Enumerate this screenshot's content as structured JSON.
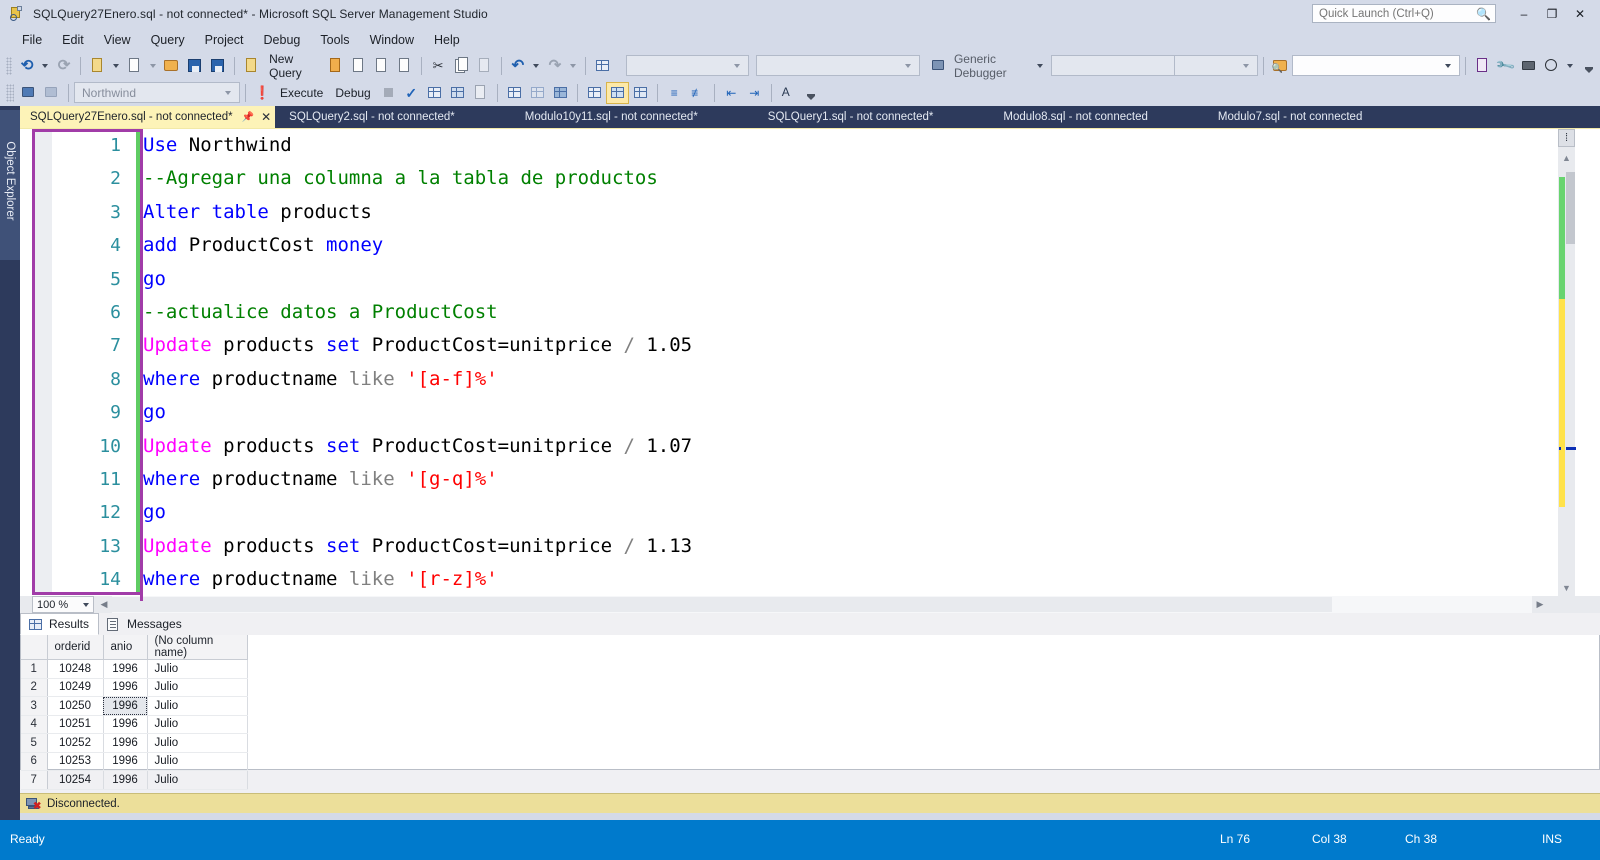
{
  "window": {
    "title": "SQLQuery27Enero.sql - not connected* - Microsoft SQL Server Management Studio",
    "app_icon": "sql-file-icon",
    "minimize_label": "–",
    "restore_label": "❐",
    "close_label": "✕"
  },
  "quick_launch": {
    "placeholder": "Quick Launch (Ctrl+Q)",
    "value": "",
    "icon": "search-icon"
  },
  "menubar": {
    "items": [
      {
        "label": "File"
      },
      {
        "label": "Edit"
      },
      {
        "label": "View"
      },
      {
        "label": "Query"
      },
      {
        "label": "Project"
      },
      {
        "label": "Debug"
      },
      {
        "label": "Tools"
      },
      {
        "label": "Window"
      },
      {
        "label": "Help"
      }
    ]
  },
  "toolbar_standard": {
    "navigate_back": "navigate-back-icon",
    "navigate_forward": "navigate-forward-icon",
    "new_project": "new-project-icon",
    "add_item": "add-new-item-icon",
    "open_file": "open-file-icon",
    "save": "save-icon",
    "save_all": "save-all-icon",
    "new_query_label": "New Query",
    "new_query_icon": "new-query-icon",
    "database_engine_query_icon": "database-engine-query-icon",
    "mdx_query_icon": "mdx-query-icon",
    "dmx_query_icon": "dmx-query-icon",
    "xmla_query_icon": "xmla-query-icon",
    "cut": "cut-icon",
    "copy": "copy-icon",
    "paste": "paste-icon",
    "undo": "undo-icon",
    "redo": "redo-icon",
    "show_diagram_pane": "show-diagram-pane-icon"
  },
  "toolbar_sql_editor": {
    "connect": "connect-icon",
    "disconnect": "disconnect-icon",
    "database_value": "Northwind",
    "execute_label": "Execute",
    "execute_icon": "execute-run-icon",
    "debug_label": "Debug",
    "stop_icon": "stop-icon",
    "parse_icon": "parse-check-icon",
    "display_estimated_plan_icon": "display-estimated-execution-plan-icon",
    "query_options_icon": "query-options-icon",
    "include_actual_plan_icon": "include-actual-execution-plan-icon",
    "include_client_stats_icon": "include-client-statistics-icon",
    "results_to_text_icon": "results-to-text-icon",
    "results_to_grid_icon": "results-to-grid-icon",
    "results_to_file_icon": "results-to-file-icon",
    "comment_icon": "comment-selection-icon",
    "uncomment_icon": "uncomment-selection-icon",
    "decrease_indent_icon": "decrease-indent-icon",
    "increase_indent_icon": "increase-indent-icon",
    "specify_values_icon": "specify-values-for-template-parameters-icon",
    "overflow_icon": "toolbar-overflow-icon"
  },
  "toolbar_debug": {
    "process_value": "",
    "thread_value": "",
    "debugger_label": "Generic Debugger",
    "debugger_icon": "debugger-icon",
    "stackframe_value": ""
  },
  "toolbar_find": {
    "find_in_files_icon": "find-in-files-icon",
    "find_value": "",
    "new_query_with_current_connection_icon": "excel-query-icon",
    "options_icon": "wrench-options-icon",
    "toolbox_icon": "toolbox-icon",
    "web_browser_icon": "web-browser-icon",
    "overflow_icon": "toolbar-overflow-icon"
  },
  "sidebar": {
    "object_explorer_label": "Object Explorer"
  },
  "document_tabs": [
    {
      "label": "SQLQuery27Enero.sql - not connected*",
      "active": true,
      "pin_icon": "pin-icon",
      "close_icon": "close-icon"
    },
    {
      "label": "SQLQuery2.sql - not connected*",
      "active": false
    },
    {
      "label": "Modulo10y11.sql - not connected*",
      "active": false
    },
    {
      "label": "SQLQuery1.sql - not connected*",
      "active": false
    },
    {
      "label": "Modulo8.sql - not connected",
      "active": false
    },
    {
      "label": "Modulo7.sql - not connected",
      "active": false
    }
  ],
  "editor": {
    "zoom_value": "100 %",
    "scroll_markers": {
      "modified_color": "#68d46f",
      "saved_color": "#ffe24a",
      "cursor_color": "#0b2fb5"
    },
    "selection_border_color": "#a13ca8",
    "lines": [
      {
        "n": "1",
        "tokens": [
          {
            "t": "Use",
            "c": "blue"
          },
          {
            "t": " Northwind",
            "c": "blk"
          }
        ]
      },
      {
        "n": "2",
        "tokens": [
          {
            "t": "--Agregar una columna a la tabla de productos",
            "c": "grn"
          }
        ]
      },
      {
        "n": "3",
        "tokens": [
          {
            "t": "Alter table",
            "c": "blue"
          },
          {
            "t": " products",
            "c": "blk"
          }
        ]
      },
      {
        "n": "4",
        "tokens": [
          {
            "t": "add",
            "c": "blue"
          },
          {
            "t": " ProductCost ",
            "c": "blk"
          },
          {
            "t": "money",
            "c": "blue"
          }
        ]
      },
      {
        "n": "5",
        "tokens": [
          {
            "t": "go",
            "c": "blue"
          }
        ]
      },
      {
        "n": "6",
        "tokens": [
          {
            "t": "--actualice datos a ProductCost",
            "c": "grn"
          }
        ]
      },
      {
        "n": "7",
        "tokens": [
          {
            "t": "Update",
            "c": "mag"
          },
          {
            "t": " products ",
            "c": "blk"
          },
          {
            "t": "set",
            "c": "blue"
          },
          {
            "t": " ProductCost=unitprice ",
            "c": "blk"
          },
          {
            "t": "/",
            "c": "gry"
          },
          {
            "t": " 1.05",
            "c": "blk"
          }
        ]
      },
      {
        "n": "8",
        "tokens": [
          {
            "t": "where",
            "c": "blue"
          },
          {
            "t": " productname ",
            "c": "blk"
          },
          {
            "t": "like",
            "c": "gry"
          },
          {
            "t": " ",
            "c": "blk"
          },
          {
            "t": "'[a-f]%'",
            "c": "red"
          }
        ]
      },
      {
        "n": "9",
        "tokens": [
          {
            "t": "go",
            "c": "blue"
          }
        ]
      },
      {
        "n": "10",
        "tokens": [
          {
            "t": "Update",
            "c": "mag"
          },
          {
            "t": " products ",
            "c": "blk"
          },
          {
            "t": "set",
            "c": "blue"
          },
          {
            "t": " ProductCost=unitprice ",
            "c": "blk"
          },
          {
            "t": "/",
            "c": "gry"
          },
          {
            "t": " 1.07",
            "c": "blk"
          }
        ]
      },
      {
        "n": "11",
        "tokens": [
          {
            "t": "where",
            "c": "blue"
          },
          {
            "t": " productname ",
            "c": "blk"
          },
          {
            "t": "like",
            "c": "gry"
          },
          {
            "t": " ",
            "c": "blk"
          },
          {
            "t": "'[g-q]%'",
            "c": "red"
          }
        ]
      },
      {
        "n": "12",
        "tokens": [
          {
            "t": "go",
            "c": "blue"
          }
        ]
      },
      {
        "n": "13",
        "tokens": [
          {
            "t": "Update",
            "c": "mag"
          },
          {
            "t": " products ",
            "c": "blk"
          },
          {
            "t": "set",
            "c": "blue"
          },
          {
            "t": " ProductCost=unitprice ",
            "c": "blk"
          },
          {
            "t": "/",
            "c": "gry"
          },
          {
            "t": " 1.13",
            "c": "blk"
          }
        ]
      },
      {
        "n": "14",
        "tokens": [
          {
            "t": "where",
            "c": "blue"
          },
          {
            "t": " productname ",
            "c": "blk"
          },
          {
            "t": "like",
            "c": "gry"
          },
          {
            "t": " ",
            "c": "blk"
          },
          {
            "t": "'[r-z]%'",
            "c": "red"
          }
        ]
      }
    ]
  },
  "results": {
    "tabs": [
      {
        "label": "Results",
        "icon": "results-grid-icon",
        "active": true
      },
      {
        "label": "Messages",
        "icon": "messages-icon",
        "active": false
      }
    ],
    "columns": [
      "",
      "orderid",
      "anio",
      "(No column name)"
    ],
    "rows": [
      {
        "n": "1",
        "orderid": "10248",
        "anio": "1996",
        "name": "Julio",
        "selected": false
      },
      {
        "n": "2",
        "orderid": "10249",
        "anio": "1996",
        "name": "Julio",
        "selected": false
      },
      {
        "n": "3",
        "orderid": "10250",
        "anio": "1996",
        "name": "Julio",
        "selected": true
      },
      {
        "n": "4",
        "orderid": "10251",
        "anio": "1996",
        "name": "Julio",
        "selected": false
      },
      {
        "n": "5",
        "orderid": "10252",
        "anio": "1996",
        "name": "Julio",
        "selected": false
      },
      {
        "n": "6",
        "orderid": "10253",
        "anio": "1996",
        "name": "Julio",
        "selected": false
      },
      {
        "n": "7",
        "orderid": "10254",
        "anio": "1996",
        "name": "Julio",
        "selected": false
      }
    ]
  },
  "connection_bar": {
    "status_text": "Disconnected.",
    "icon": "disconnected-icon",
    "background": "#ecdf9a"
  },
  "statusbar": {
    "ready": "Ready",
    "line": "Ln 76",
    "column": "Col 38",
    "character": "Ch 38",
    "insert_mode": "INS",
    "background": "#007acc"
  }
}
